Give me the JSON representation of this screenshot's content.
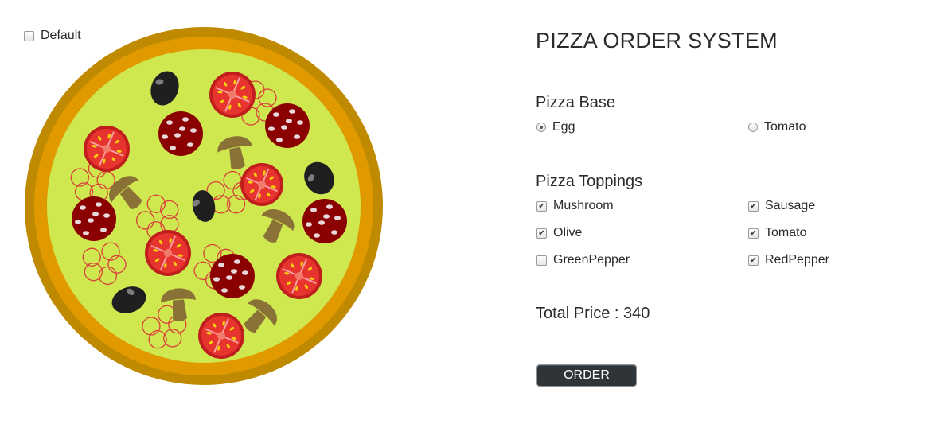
{
  "default_option": {
    "label": "Default",
    "checked": false
  },
  "title": "PIZZA ORDER SYSTEM",
  "base": {
    "heading": "Pizza Base",
    "options": [
      {
        "label": "Egg",
        "selected": true
      },
      {
        "label": "Tomato",
        "selected": false
      }
    ]
  },
  "toppings": {
    "heading": "Pizza Toppings",
    "items": [
      {
        "label": "Mushroom",
        "checked": true
      },
      {
        "label": "Sausage",
        "checked": true
      },
      {
        "label": "Olive",
        "checked": true
      },
      {
        "label": "Tomato",
        "checked": true
      },
      {
        "label": "GreenPepper",
        "checked": false
      },
      {
        "label": "RedPepper",
        "checked": true
      }
    ]
  },
  "price_text": "Total Price : 340",
  "order_label": "ORDER",
  "colors": {
    "crust_outer": "#c08a00",
    "crust_inner": "#e09a00",
    "cheese": "#cfe84f",
    "tomato": "#e8342f",
    "sausage": "#8b0000",
    "olive": "#1f1f1f",
    "mushroom": "#8a7237",
    "red_pepper_outline": "#d9403a"
  }
}
